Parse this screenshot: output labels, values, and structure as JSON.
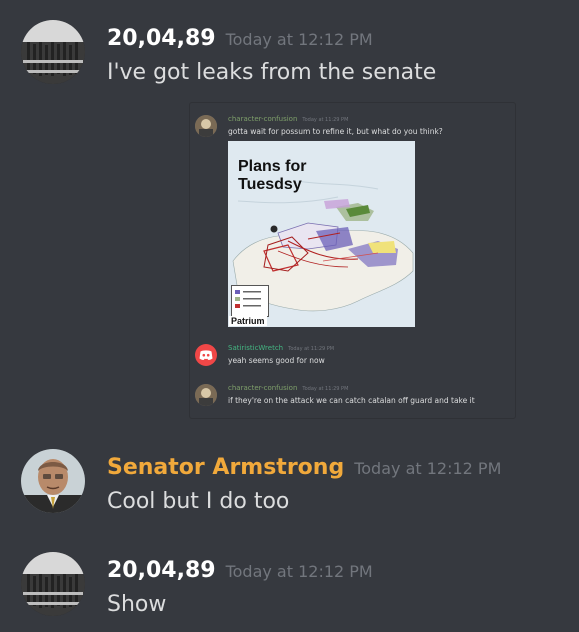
{
  "messages": [
    {
      "username": "20,04,89",
      "timestamp": "Today at 12:12 PM",
      "text": "I've got leaks from the senate",
      "avatar_icon": "crowd-avatar-icon"
    },
    {
      "username": "Senator Armstrong",
      "timestamp": "Today at 12:12 PM",
      "text": "Cool but I do too",
      "avatar_icon": "senator-avatar-icon",
      "name_color": "#f1a93b"
    },
    {
      "username": "20,04,89",
      "timestamp": "Today at 12:12 PM",
      "text": "Show",
      "avatar_icon": "crowd-avatar-icon"
    }
  ],
  "embed": {
    "messages": [
      {
        "username": "character-confusion",
        "timestamp": "Today at 11:29 PM",
        "text": "gotta wait for possum to refine it, but what do you think?"
      },
      {
        "username": "SatiristicWretch",
        "timestamp": "Today at 11:29 PM",
        "text": "yeah seems good for now"
      },
      {
        "username": "character-confusion",
        "timestamp": "Today at 11:29 PM",
        "text": "if they're on the attack we can catch catalan off guard and take it"
      }
    ],
    "map": {
      "title_line1": "Plans for",
      "title_line2": "Tuesdsy",
      "footer": "Patrium"
    }
  },
  "colors": {
    "background": "#36393f",
    "timestamp": "#72767d",
    "senator_name": "#f1a93b"
  }
}
